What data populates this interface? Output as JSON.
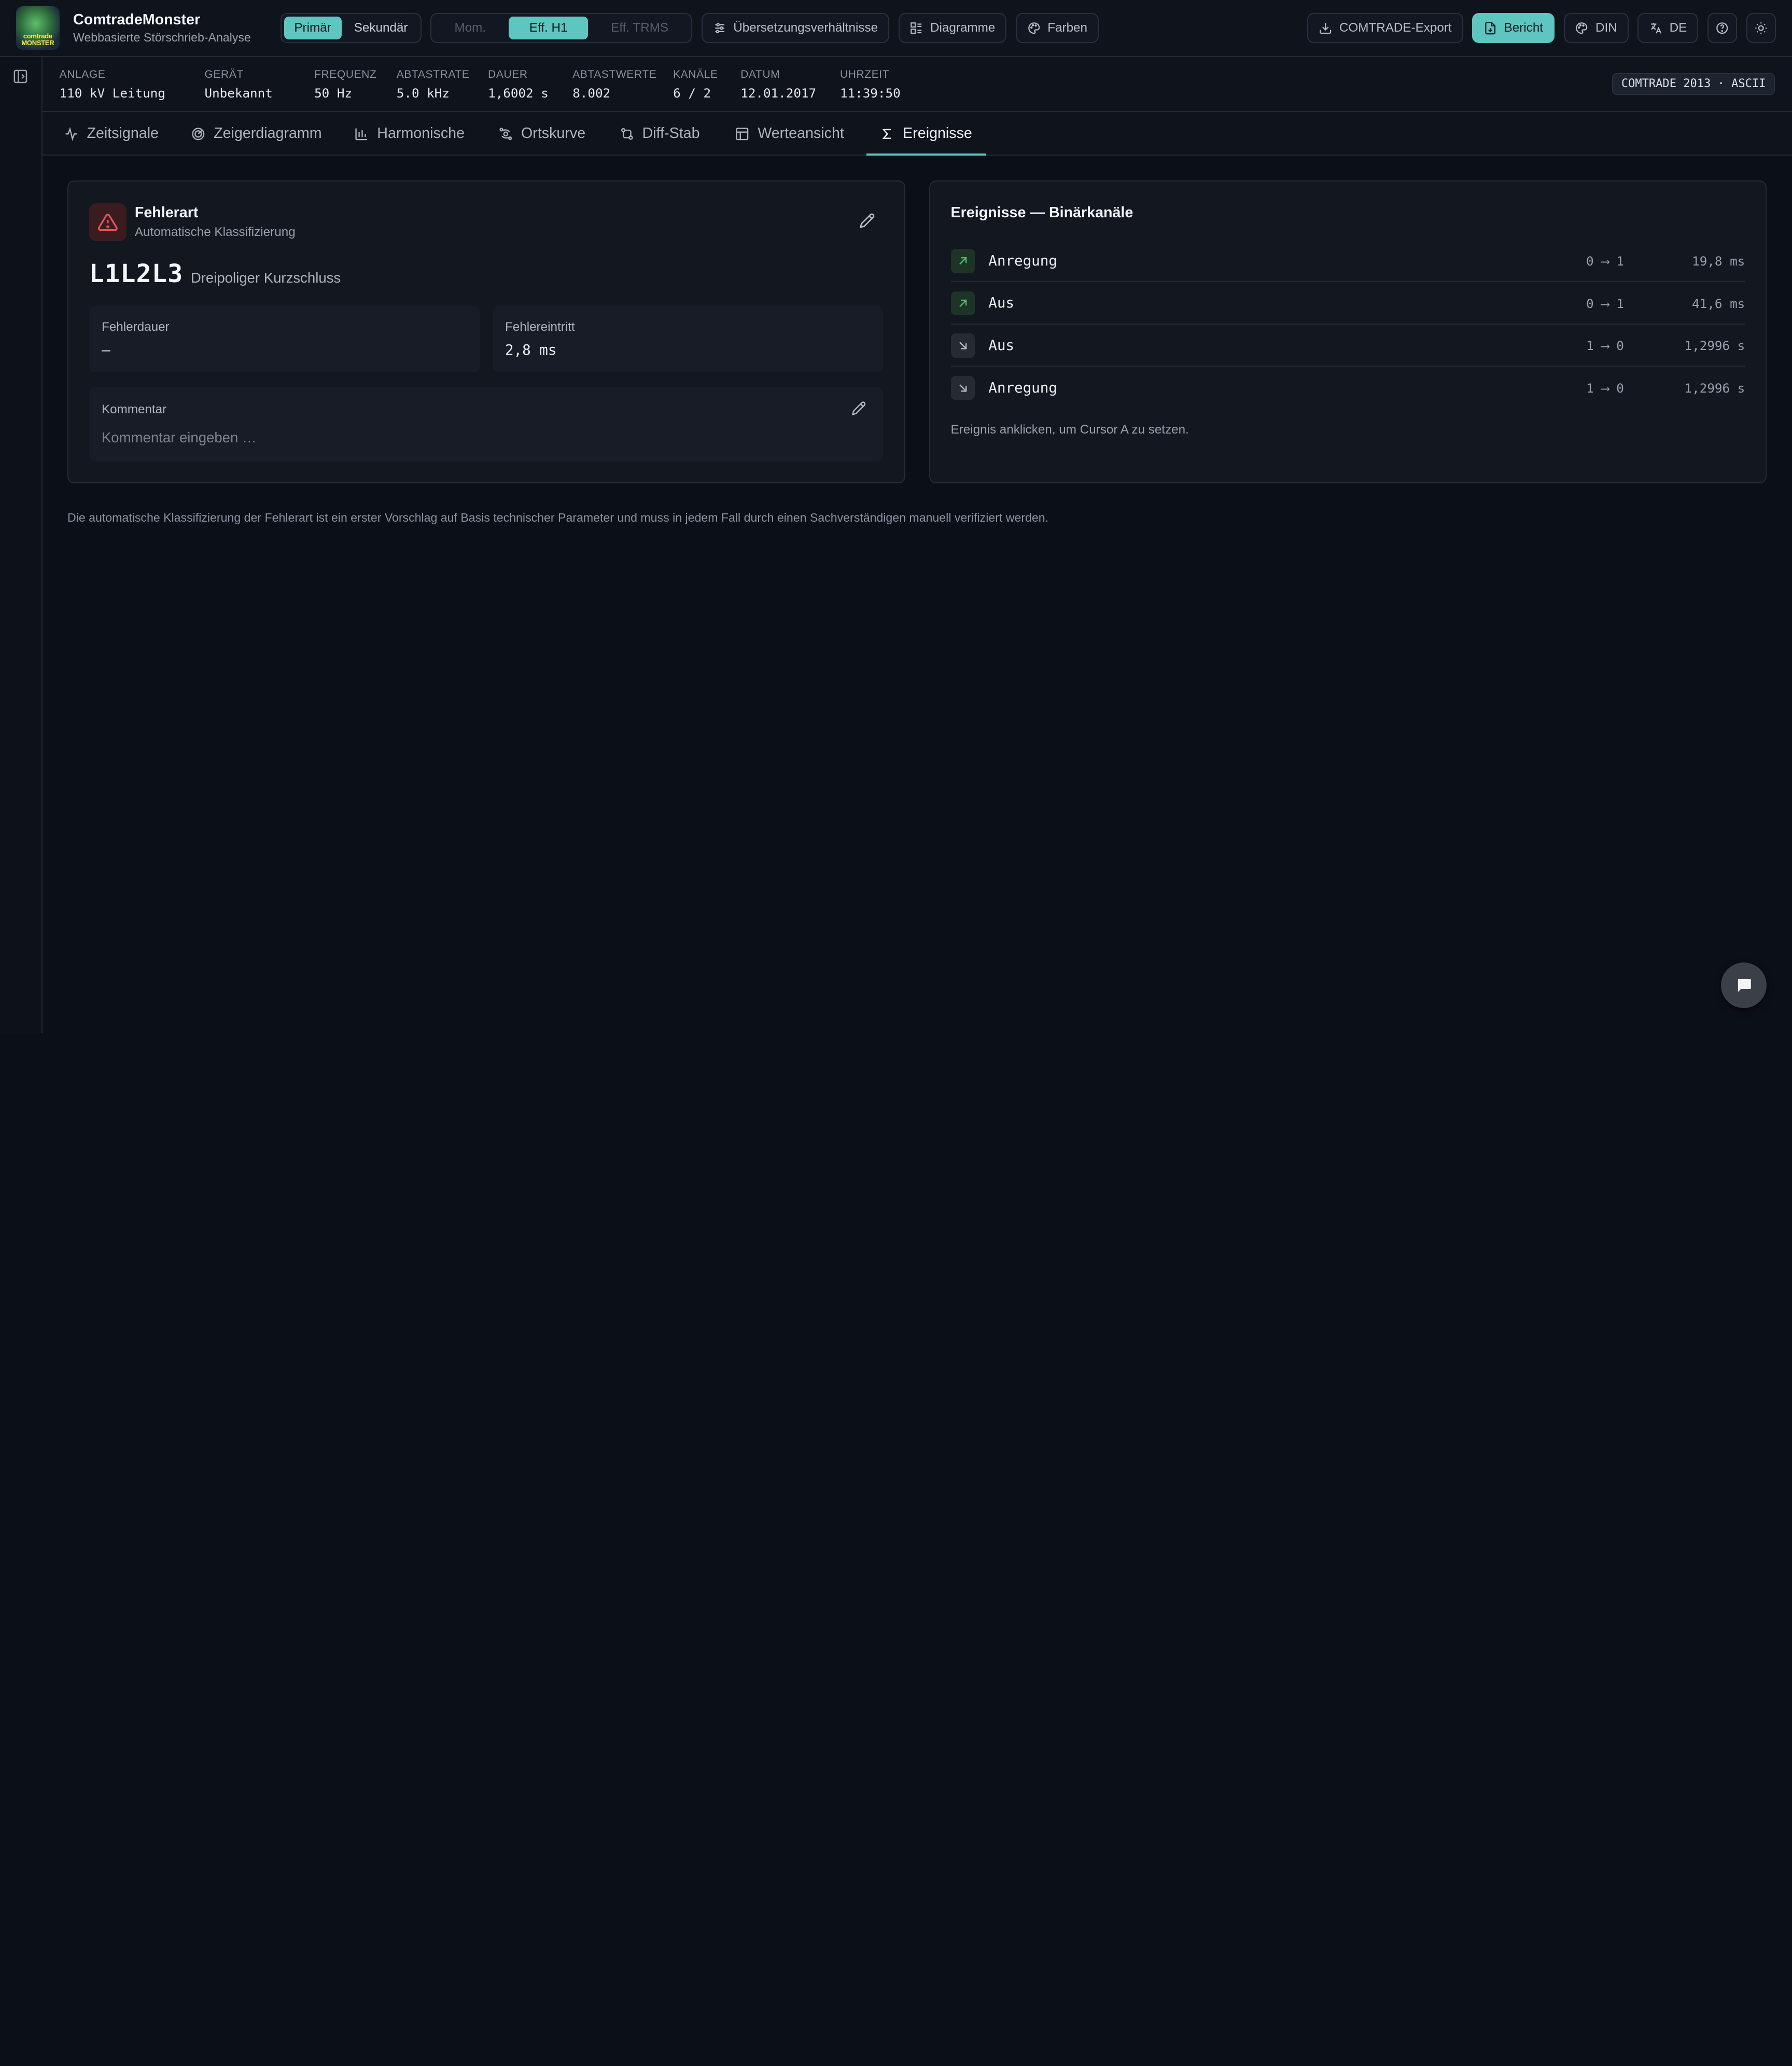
{
  "app": {
    "name": "ComtradeMonster",
    "subtitle": "Webbasierte Störschrieb-Analyse",
    "logo_text": "comtrade MONSTER"
  },
  "toolbar": {
    "side_options": [
      {
        "label": "Primär",
        "active": true
      },
      {
        "label": "Sekundär",
        "active": false
      }
    ],
    "value_modes": [
      {
        "label": "Mom.",
        "state": "disabled"
      },
      {
        "label": "Eff. H1",
        "state": "active"
      },
      {
        "label": "Eff. TRMS",
        "state": "disabled"
      }
    ],
    "ratios_label": "Übersetzungsverhältnisse",
    "diagrams_label": "Diagramme",
    "colors_label": "Farben",
    "export_label": "COMTRADE-Export",
    "report_label": "Bericht",
    "standard_label": "DIN",
    "language_label": "DE"
  },
  "info": {
    "anlage_label": "ANLAGE",
    "anlage": "110 kV Leitung",
    "geraet_label": "GERÄT",
    "geraet": "Unbekannt",
    "frequenz_label": "FREQUENZ",
    "frequenz": "50 Hz",
    "abtastrate_label": "ABTASTRATE",
    "abtastrate": "5.0 kHz",
    "dauer_label": "DAUER",
    "dauer": "1,6002 s",
    "abtastwerte_label": "ABTASTWERTE",
    "abtastwerte": "8.002",
    "kanaele_label": "KANÄLE",
    "kanaele": "6 / 2",
    "datum_label": "DATUM",
    "datum": "12.01.2017",
    "uhrzeit_label": "UHRZEIT",
    "uhrzeit": "11:39:50",
    "format": "COMTRADE 2013 · ASCII"
  },
  "tabs": [
    {
      "label": "Zeitsignale",
      "icon": "activity-icon"
    },
    {
      "label": "Zeigerdiagramm",
      "icon": "target-icon"
    },
    {
      "label": "Harmonische",
      "icon": "bar-chart-icon"
    },
    {
      "label": "Ortskurve",
      "icon": "orbit-icon"
    },
    {
      "label": "Diff-Stab",
      "icon": "git-compare-icon"
    },
    {
      "label": "Werteansicht",
      "icon": "table-icon"
    },
    {
      "label": "Ereignisse",
      "icon": "sigma-icon",
      "active": true
    }
  ],
  "fault": {
    "title": "Fehlerart",
    "subtitle": "Automatische Klassifizierung",
    "code": "L1L2L3",
    "description": "Dreipoliger Kurzschluss",
    "duration_label": "Fehlerdauer",
    "duration": "–",
    "onset_label": "Fehlereintritt",
    "onset": "2,8 ms",
    "comment_label": "Kommentar",
    "comment_placeholder": "Kommentar eingeben …"
  },
  "events": {
    "title": "Ereignisse — Binärkanäle",
    "rows": [
      {
        "name": "Anregung",
        "direction": "rising",
        "transition": "0 ⟶ 1",
        "time": "19,8 ms"
      },
      {
        "name": "Aus",
        "direction": "rising",
        "transition": "0 ⟶ 1",
        "time": "41,6 ms"
      },
      {
        "name": "Aus",
        "direction": "falling",
        "transition": "1 ⟶ 0",
        "time": "1,2996 s"
      },
      {
        "name": "Anregung",
        "direction": "falling",
        "transition": "1 ⟶ 0",
        "time": "1,2996 s"
      }
    ],
    "hint": "Ereignis anklicken, um Cursor A zu setzen."
  },
  "disclaimer": "Die automatische Klassifizierung der Fehlerart ist ein erster Vorschlag auf Basis technischer Parameter und muss in jedem Fall durch einen Sachverständigen manuell verifiziert werden.",
  "colors": {
    "accent": "#5ec5c0",
    "background": "#0b0f17",
    "danger": "#e5535a",
    "rising": "#4fb86a"
  }
}
